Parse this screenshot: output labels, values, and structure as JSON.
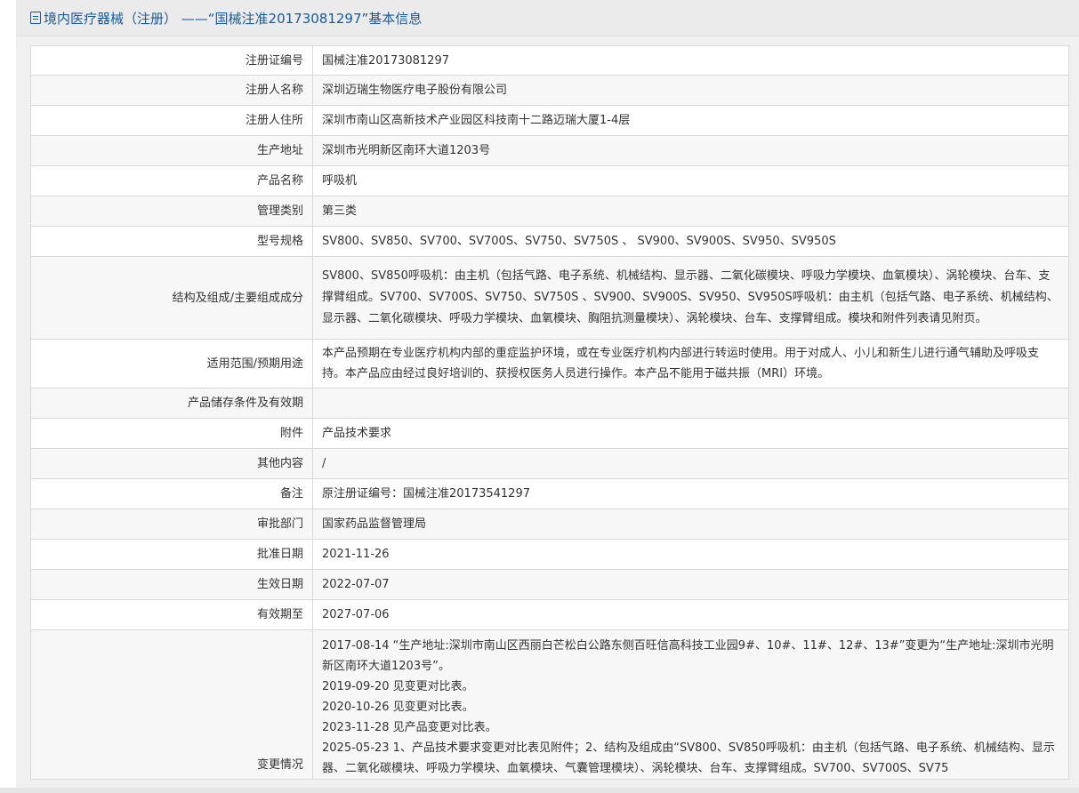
{
  "header": {
    "title": "境内医疗器械（注册） ——“国械注准20173081297”基本信息"
  },
  "rows": [
    {
      "label": "注册证编号",
      "value": "国械注准20173081297"
    },
    {
      "label": "注册人名称",
      "value": "深圳迈瑞生物医疗电子股份有限公司"
    },
    {
      "label": "注册人住所",
      "value": "深圳市南山区高新技术产业园区科技南十二路迈瑞大厦1-4层"
    },
    {
      "label": "生产地址",
      "value": "深圳市光明新区南环大道1203号"
    },
    {
      "label": "产品名称",
      "value": "呼吸机"
    },
    {
      "label": "管理类别",
      "value": "第三类"
    },
    {
      "label": "型号规格",
      "value": "SV800、SV850、SV700、SV700S、SV750、SV750S 、 SV900、SV900S、SV950、SV950S"
    },
    {
      "label": "结构及组成/主要组成成分",
      "value": "SV800、SV850呼吸机：由主机（包括气路、电子系统、机械结构、显示器、二氧化碳模块、呼吸力学模块、血氧模块）、涡轮模块、台车、支撑臂组成。SV700、SV700S、SV750、SV750S 、SV900、SV900S、SV950、SV950S呼吸机：由主机（包括气路、电子系统、机械结构、显示器、二氧化碳模块、呼吸力学模块、血氧模块、胸阻抗测量模块）、涡轮模块、台车、支撑臂组成。模块和附件列表请见附页。"
    },
    {
      "label": "适用范围/预期用途",
      "value": "本产品预期在专业医疗机构内部的重症监护环境，或在专业医疗机构内部进行转运时使用。用于对成人、小儿和新生儿进行通气辅助及呼吸支持。本产品应由经过良好培训的、获授权医务人员进行操作。本产品不能用于磁共振（MRI）环境。"
    },
    {
      "label": "产品储存条件及有效期",
      "value": ""
    },
    {
      "label": "附件",
      "value": "产品技术要求"
    },
    {
      "label": "其他内容",
      "value": "/"
    },
    {
      "label": "备注",
      "value": "原注册证编号：国械注准20173541297"
    },
    {
      "label": "审批部门",
      "value": "国家药品监督管理局"
    },
    {
      "label": "批准日期",
      "value": "2021-11-26"
    },
    {
      "label": "生效日期",
      "value": "2022-07-07"
    },
    {
      "label": "有效期至",
      "value": "2027-07-06"
    }
  ],
  "changes": {
    "label": "变更情况",
    "lines": [
      "2017-08-14 “生产地址:深圳市南山区西丽白芒松白公路东侧百旺信高科技工业园9#、10#、11#、12#、13#”变更为“生产地址:深圳市光明新区南环大道1203号”。",
      "2019-09-20 见变更对比表。",
      "2020-10-26 见变更对比表。",
      "2023-11-28 见产品变更对比表。",
      "2025-05-23 1、产品技术要求变更对比表见附件；2、结构及组成由“SV800、SV850呼吸机：由主机（包括气路、电子系统、机械结构、显示器、二氧化碳模块、呼吸力学模块、血氧模块、气囊管理模块）、涡轮模块、台车、支撑臂组成。SV700、SV700S、SV75"
    ]
  }
}
